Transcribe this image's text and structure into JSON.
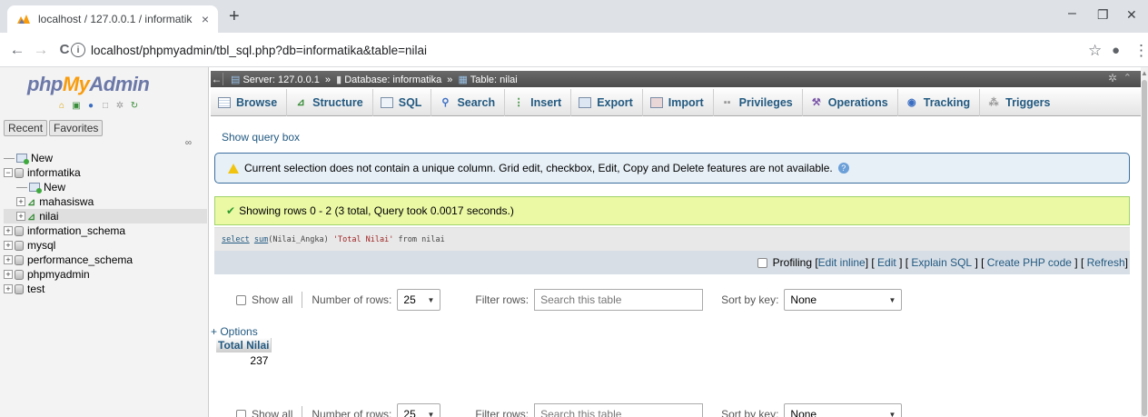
{
  "browser": {
    "tab_title": "localhost / 127.0.0.1 / informatik",
    "tab_close": "×",
    "new_tab": "+",
    "minimize": "–",
    "maximize": "❐",
    "close": "✕",
    "back": "←",
    "forward": "→",
    "reload": "C",
    "url": "localhost/phpmyadmin/tbl_sql.php?db=informatika&table=nilai",
    "star": "☆",
    "profile": "●",
    "menu": "⋮"
  },
  "nav": {
    "logo_php": "php",
    "logo_my": "My",
    "logo_admin": "Admin",
    "recent": "Recent",
    "favorites": "Favorites",
    "tree": [
      {
        "label": "New",
        "level": 0
      },
      {
        "label": "informatika",
        "level": 0
      },
      {
        "label": "New",
        "level": 1
      },
      {
        "label": "mahasiswa",
        "level": 1
      },
      {
        "label": "nilai",
        "level": 1
      },
      {
        "label": "information_schema",
        "level": 0
      },
      {
        "label": "mysql",
        "level": 0
      },
      {
        "label": "performance_schema",
        "level": 0
      },
      {
        "label": "phpmyadmin",
        "level": 0
      },
      {
        "label": "test",
        "level": 0
      }
    ]
  },
  "breadcrumb": {
    "server": "Server: 127.0.0.1",
    "database": "Database: informatika",
    "table": "Table: nilai",
    "sep": "»"
  },
  "menu_tabs": [
    {
      "label": "Browse",
      "icon": "browse-icon"
    },
    {
      "label": "Structure",
      "icon": "structure-icon"
    },
    {
      "label": "SQL",
      "icon": "sql-icon"
    },
    {
      "label": "Search",
      "icon": "search-icon"
    },
    {
      "label": "Insert",
      "icon": "insert-icon"
    },
    {
      "label": "Export",
      "icon": "export-icon"
    },
    {
      "label": "Import",
      "icon": "import-icon"
    },
    {
      "label": "Privileges",
      "icon": "privileges-icon"
    },
    {
      "label": "Operations",
      "icon": "operations-icon"
    },
    {
      "label": "Tracking",
      "icon": "tracking-icon"
    },
    {
      "label": "Triggers",
      "icon": "triggers-icon"
    }
  ],
  "show_query_box": "Show query box",
  "notice": "Current selection does not contain a unique column. Grid edit, checkbox, Edit, Copy and Delete features are not available.",
  "success": "Showing rows 0 - 2 (3 total, Query took 0.0017 seconds.)",
  "sql": {
    "select": "select",
    "sum": "sum",
    "col": "(Nilai_Angka)",
    "alias": "'Total Nilai'",
    "from": "from",
    "table": "nilai"
  },
  "profiling": {
    "label": "Profiling",
    "edit_inline": "Edit inline",
    "edit": "Edit",
    "explain": "Explain SQL",
    "create_php": "Create PHP code",
    "refresh": "Refresh"
  },
  "controls": {
    "show_all": "Show all",
    "number_of_rows_label": "Number of rows:",
    "number_of_rows_value": "25",
    "filter_rows_label": "Filter rows:",
    "filter_placeholder": "Search this table",
    "sort_by_key_label": "Sort by key:",
    "sort_by_key_value": "None"
  },
  "options_link": "+ Options",
  "result": {
    "column_header": "Total Nilai",
    "value": "237"
  }
}
